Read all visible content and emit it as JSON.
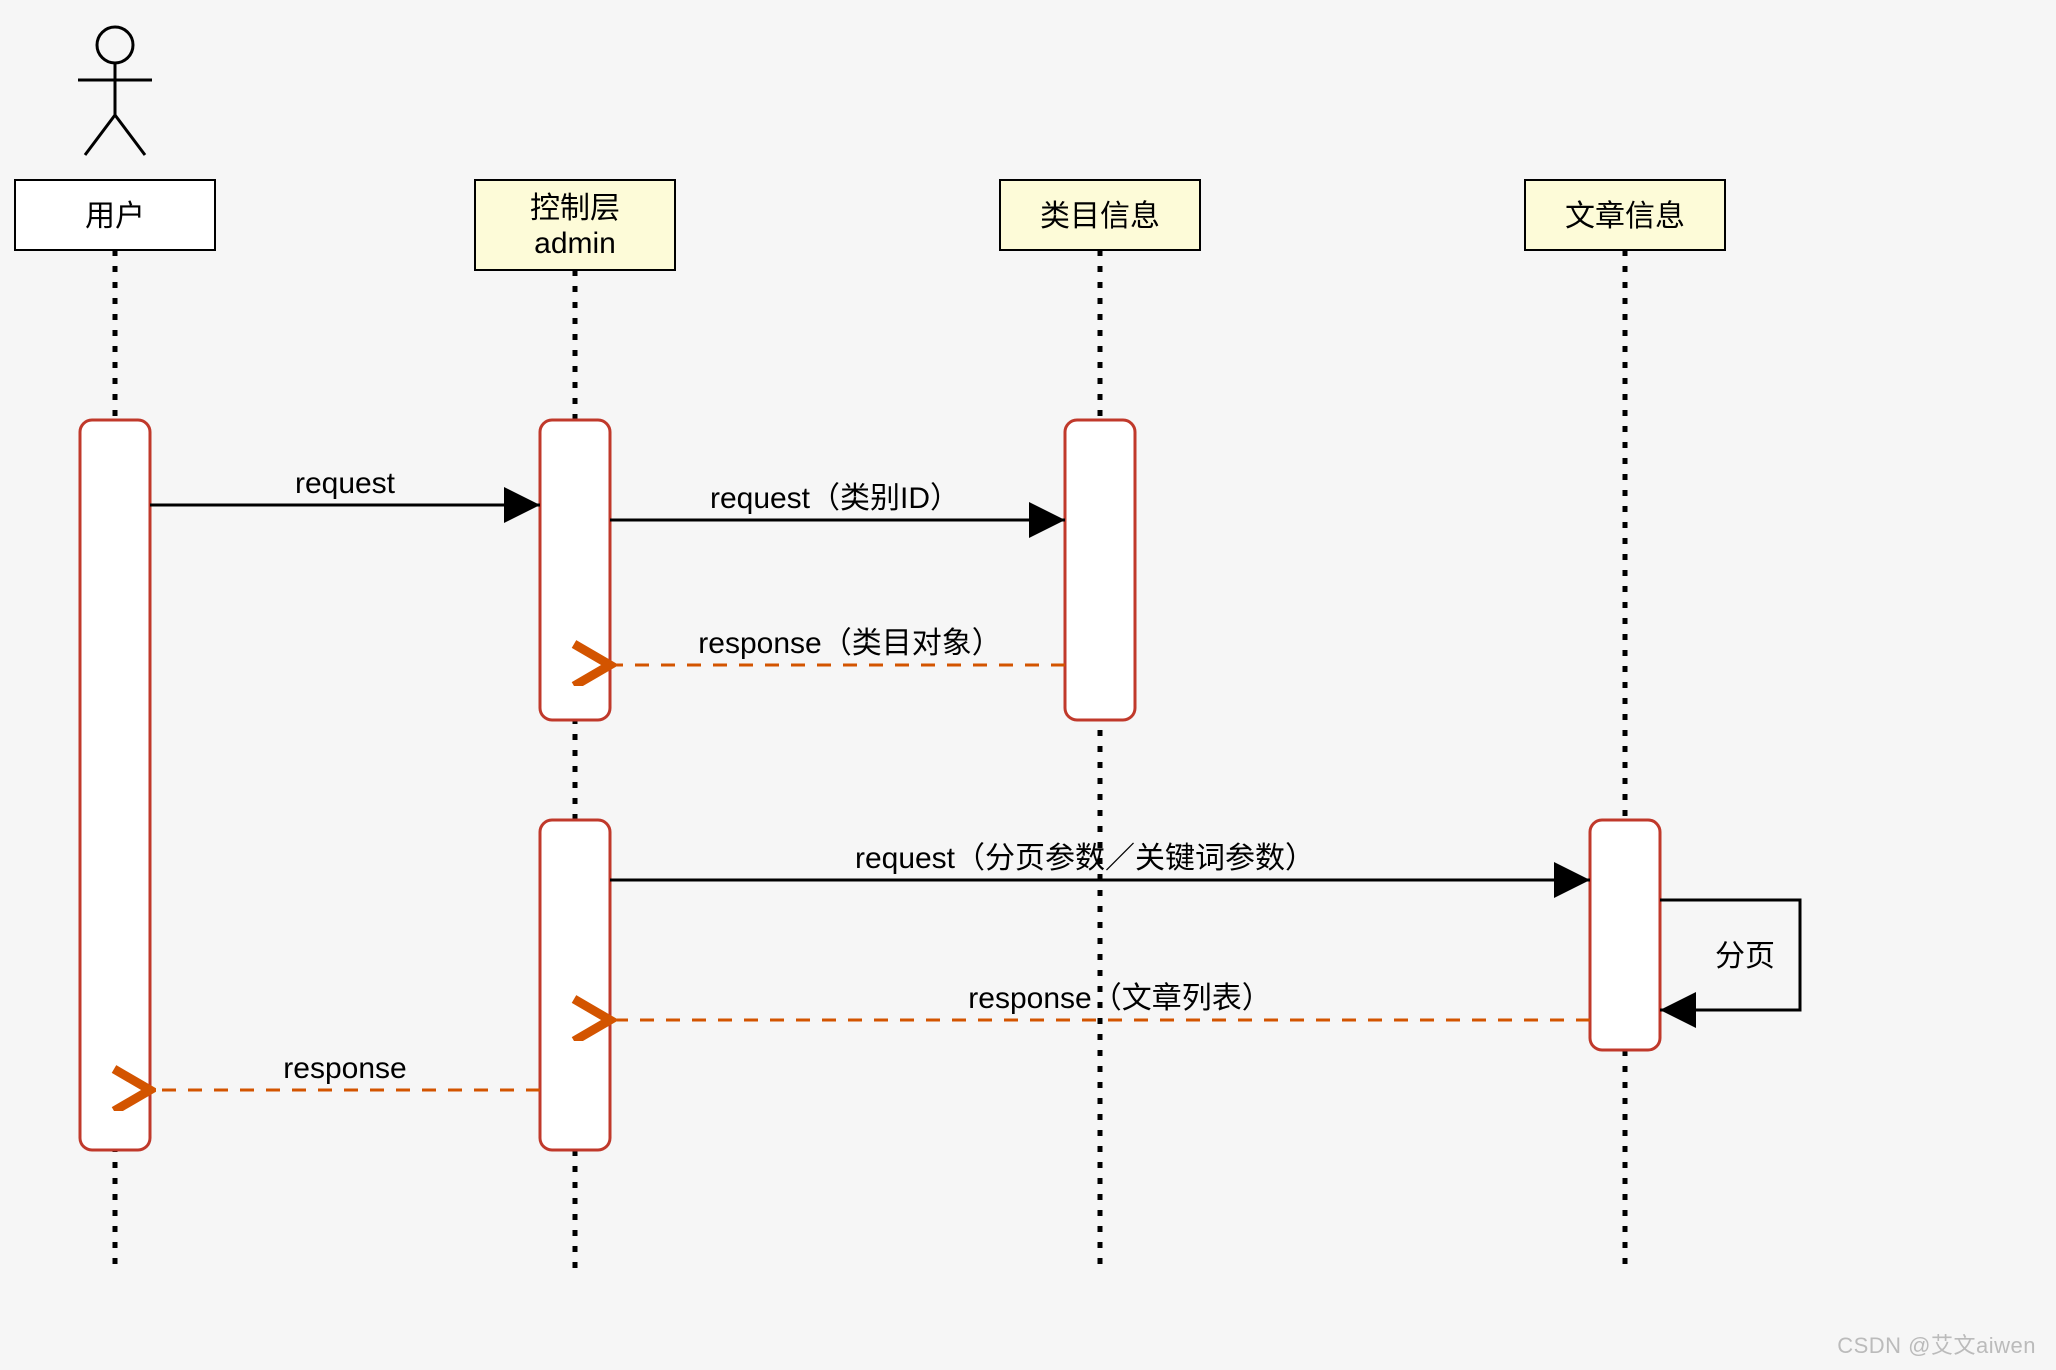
{
  "participants": {
    "user": {
      "label": "用户"
    },
    "admin": {
      "label_line1": "控制层",
      "label_line2": "admin"
    },
    "category": {
      "label": "类目信息"
    },
    "article": {
      "label": "文章信息"
    }
  },
  "messages": {
    "m1": "request",
    "m2": "request（类别ID）",
    "m3": "response（类目对象）",
    "m4": "request（分页参数／关键词参数）",
    "m5": "response（文章列表）",
    "m6": "response"
  },
  "self_msg": "分页",
  "watermark": "CSDN @艾文aiwen"
}
